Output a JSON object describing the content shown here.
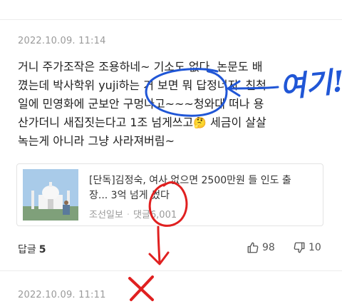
{
  "comments": [
    {
      "timestamp": "2022.10.09. 11:14",
      "lines": [
        "거니 주가조작은 조용하네~ 기소도 없다. 논문도 배",
        "꼈는데 박사학위 yuji하는 거 보면 뭐 답정너지. 친척",
        "일에 민영화에 군보안 구멍나고~~~청와대 떠나 용",
        "산가더니 새집짓는다고 1조 넘게쓰고",
        "녹는게 아니라 그냥 사라져버림~"
      ],
      "line4_tail": " 세금이 살살",
      "emoji": "thinking-face-emoji",
      "news": {
        "title_line1": "[단독]김정숙, 여사 없으면 2500만원 들 인도 출",
        "title_line2": "장... 3억 넘게 썼다",
        "source": "조선일보",
        "comment_label": "댓글",
        "comment_count": "6,001"
      },
      "reply_label": "답글",
      "reply_count": "5",
      "likes": "98",
      "dislikes": "10"
    },
    {
      "timestamp": "2022.10.09. 11:11"
    }
  ],
  "annotations": {
    "blue_text": "여기!",
    "blue_color": "#2056d6",
    "red_color": "#e02020"
  },
  "icons": {
    "like": "thumbs-up-icon",
    "dislike": "thumbs-down-icon"
  }
}
